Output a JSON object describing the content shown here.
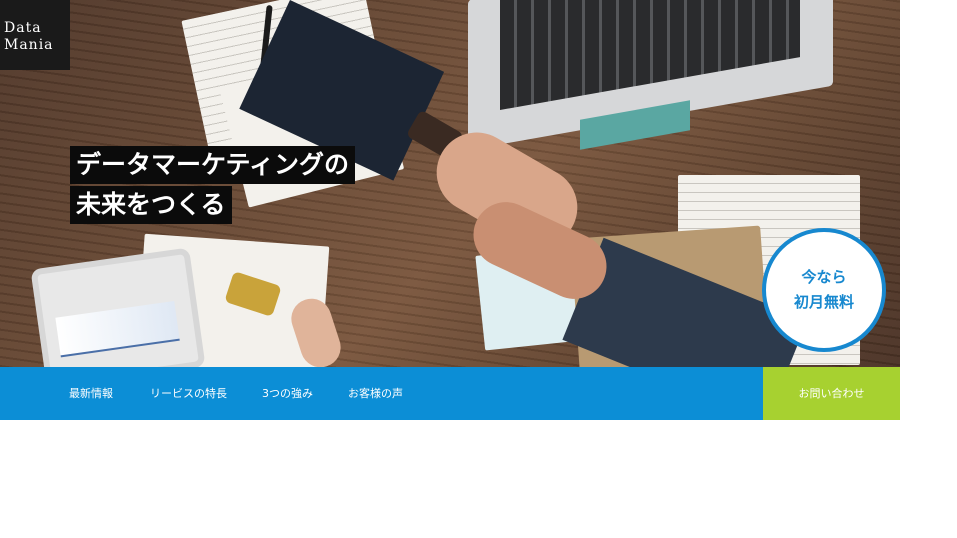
{
  "brand": {
    "logo_line1": "Data",
    "logo_line2": "Mania"
  },
  "hero": {
    "headline_line1": "データマーケティングの",
    "headline_line2": "未来をつくる"
  },
  "badge": {
    "line1": "今なら",
    "line2": "初月無料"
  },
  "nav": {
    "items": [
      {
        "label": "最新情報"
      },
      {
        "label": "リービスの特長"
      },
      {
        "label": "3つの強み"
      },
      {
        "label": "お客様の声"
      }
    ],
    "cta_label": "お問い合わせ"
  },
  "colors": {
    "nav_bg": "#0c8ed6",
    "cta_bg": "#a7d130",
    "badge_accent": "#1788cf",
    "logo_bg": "#1a1a1a"
  }
}
